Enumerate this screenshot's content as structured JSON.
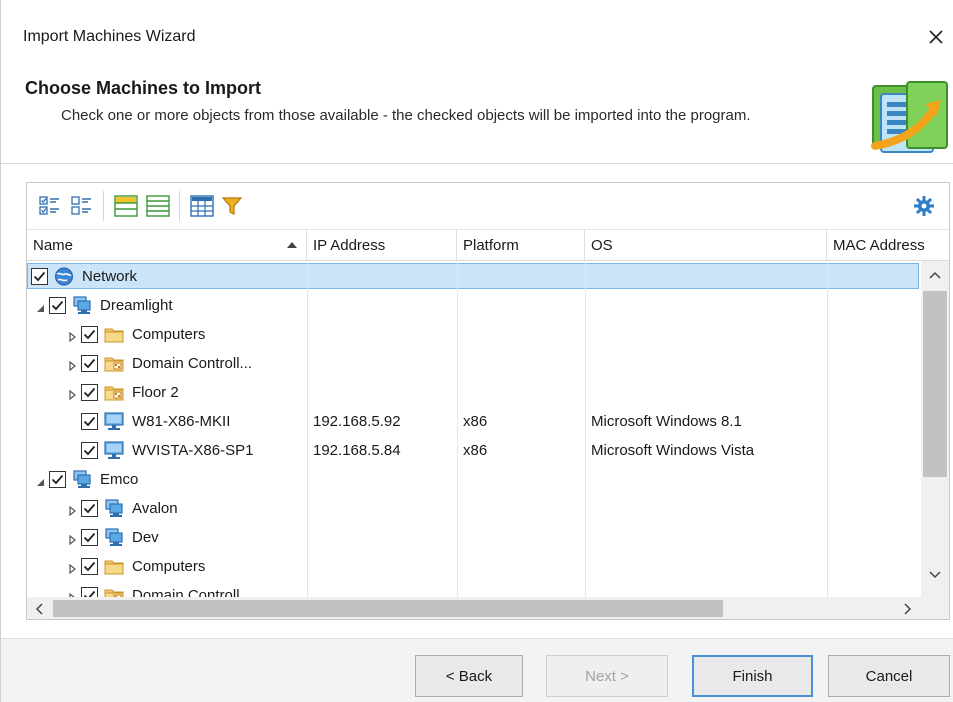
{
  "window": {
    "title": "Import Machines Wizard",
    "close_label": "×"
  },
  "header": {
    "title": "Choose Machines to Import",
    "description": "Check one or more objects from those available - the checked objects will be imported into the program.",
    "art_icon": "import-machines-icon"
  },
  "toolbar": {
    "buttons": [
      {
        "icon": "check-all-icon"
      },
      {
        "icon": "uncheck-all-icon"
      },
      {
        "icon": "expand-groups-icon"
      },
      {
        "icon": "collapse-groups-icon"
      },
      {
        "icon": "column-chooser-icon"
      },
      {
        "icon": "filter-icon"
      }
    ],
    "settings_icon": "gear-icon"
  },
  "columns": [
    "Name",
    "IP Address",
    "Platform",
    "OS",
    "MAC Address"
  ],
  "rows": [
    {
      "name": "Network",
      "ip": "",
      "platform": "",
      "os": "",
      "icon": "globe-icon",
      "expander": "none",
      "checked": true,
      "selected": true
    },
    {
      "name": "Dreamlight",
      "ip": "",
      "platform": "",
      "os": "",
      "icon": "workgroup-icon",
      "expander": "expanded",
      "checked": true
    },
    {
      "name": "Computers",
      "ip": "",
      "platform": "",
      "os": "",
      "icon": "folder-icon",
      "expander": "collapsed",
      "checked": true
    },
    {
      "name": "Domain Controll...",
      "ip": "",
      "platform": "",
      "os": "",
      "icon": "domain-folder-icon",
      "expander": "collapsed",
      "checked": true
    },
    {
      "name": "Floor 2",
      "ip": "",
      "platform": "",
      "os": "",
      "icon": "domain-folder-icon",
      "expander": "collapsed",
      "checked": true
    },
    {
      "name": "W81-X86-MKII",
      "ip": "192.168.5.92",
      "platform": "x86",
      "os": "Microsoft Windows 8.1",
      "icon": "computer-icon",
      "expander": "none",
      "checked": true
    },
    {
      "name": "WVISTA-X86-SP1",
      "ip": "192.168.5.84",
      "platform": "x86",
      "os": "Microsoft Windows Vista",
      "icon": "computer-icon",
      "expander": "none",
      "checked": true
    },
    {
      "name": "Emco",
      "ip": "",
      "platform": "",
      "os": "",
      "icon": "workgroup-icon",
      "expander": "expanded",
      "checked": true
    },
    {
      "name": "Avalon",
      "ip": "",
      "platform": "",
      "os": "",
      "icon": "workgroup-icon",
      "expander": "collapsed",
      "checked": true
    },
    {
      "name": "Dev",
      "ip": "",
      "platform": "",
      "os": "",
      "icon": "workgroup-icon",
      "expander": "collapsed",
      "checked": true
    },
    {
      "name": "Computers",
      "ip": "",
      "platform": "",
      "os": "",
      "icon": "folder-icon",
      "expander": "collapsed",
      "checked": true
    },
    {
      "name": "Domain Controll...",
      "ip": "",
      "platform": "",
      "os": "",
      "icon": "domain-folder-icon",
      "expander": "collapsed",
      "checked": true
    }
  ],
  "footer": {
    "back_label": "< Back",
    "next_label": "Next >",
    "finish_label": "Finish",
    "cancel_label": "Cancel"
  },
  "colors": {
    "selection_bg": "#cce4f7",
    "selection_border": "#7eb4ea",
    "default_button_border": "#4a90d9"
  }
}
